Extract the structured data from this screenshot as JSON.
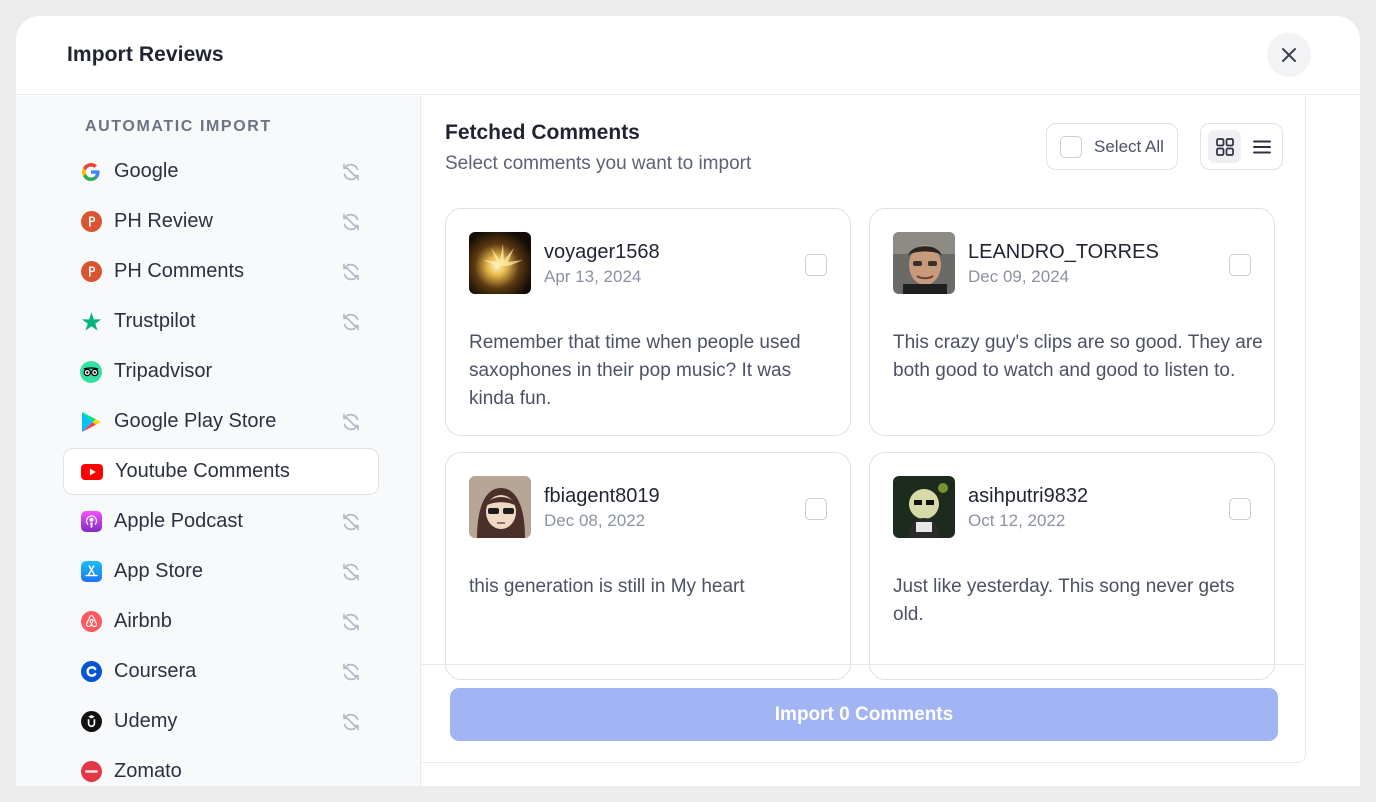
{
  "header": {
    "title": "Import Reviews"
  },
  "sidebar": {
    "section_label": "AUTOMATIC IMPORT",
    "items": [
      {
        "label": "Google",
        "icon": "google-icon",
        "sync": true,
        "active": false
      },
      {
        "label": "PH Review",
        "icon": "producthunt-icon",
        "sync": true,
        "active": false
      },
      {
        "label": "PH Comments",
        "icon": "producthunt-icon",
        "sync": true,
        "active": false
      },
      {
        "label": "Trustpilot",
        "icon": "trustpilot-icon",
        "sync": true,
        "active": false
      },
      {
        "label": "Tripadvisor",
        "icon": "tripadvisor-icon",
        "sync": false,
        "active": false
      },
      {
        "label": "Google Play Store",
        "icon": "google-play-icon",
        "sync": true,
        "active": false
      },
      {
        "label": "Youtube Comments",
        "icon": "youtube-icon",
        "sync": false,
        "active": true
      },
      {
        "label": "Apple Podcast",
        "icon": "apple-podcast-icon",
        "sync": true,
        "active": false
      },
      {
        "label": "App Store",
        "icon": "app-store-icon",
        "sync": true,
        "active": false
      },
      {
        "label": "Airbnb",
        "icon": "airbnb-icon",
        "sync": true,
        "active": false
      },
      {
        "label": "Coursera",
        "icon": "coursera-icon",
        "sync": true,
        "active": false
      },
      {
        "label": "Udemy",
        "icon": "udemy-icon",
        "sync": true,
        "active": false
      },
      {
        "label": "Zomato",
        "icon": "zomato-icon",
        "sync": false,
        "active": false
      }
    ]
  },
  "main": {
    "title": "Fetched Comments",
    "subtitle": "Select comments you want to import",
    "select_all_label": "Select All",
    "view_mode": "grid",
    "comments": [
      {
        "username": "voyager1568",
        "date": "Apr 13, 2024",
        "text": "Remember that time when people used saxophones in their pop music? It was kinda fun.",
        "checked": false
      },
      {
        "username": "LEANDRO_TORRES",
        "date": "Dec 09, 2024",
        "text": "This crazy guy's clips are so good. They are both good to watch and good to listen to.",
        "checked": false
      },
      {
        "username": "fbiagent8019",
        "date": "Dec 08, 2022",
        "text": "this generation is still in My heart",
        "checked": false
      },
      {
        "username": "asihputri9832",
        "date": "Oct 12, 2022",
        "text": "Just like yesterday. This song never gets old.",
        "checked": false
      }
    ],
    "import_button_label": "Import 0 Comments"
  },
  "colors": {
    "accent_disabled": "#a1b4f3",
    "youtube_red": "#ff0000",
    "producthunt": "#da552f",
    "trustpilot": "#00b67a",
    "tripadvisor": "#34e0a1"
  }
}
